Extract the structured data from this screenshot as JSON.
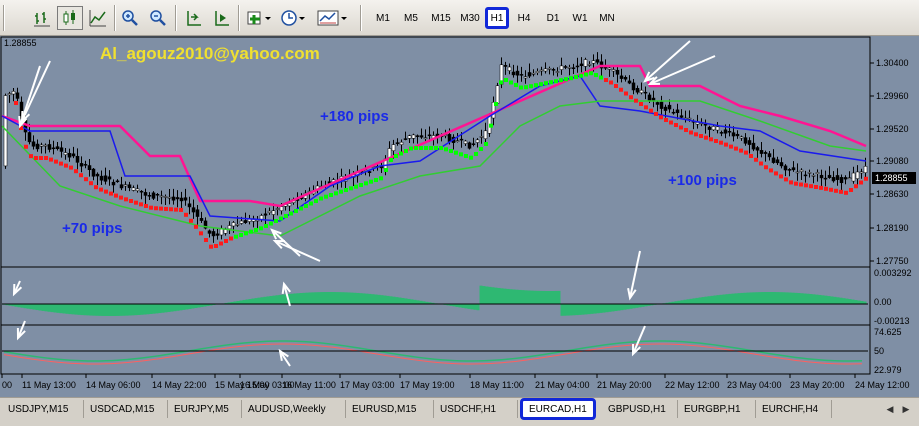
{
  "toolbar": {
    "timeframes": [
      "M1",
      "M5",
      "M15",
      "M30",
      "H1",
      "H4",
      "D1",
      "W1",
      "MN"
    ],
    "active_timeframe": "H1",
    "icons": [
      "bar-chart-icon",
      "candlestick-chart-icon",
      "line-chart-icon",
      "zoom-in-icon",
      "zoom-out-icon",
      "chart-shift-icon",
      "autoscroll-icon",
      "indicators-icon",
      "periods-icon",
      "templates-icon"
    ]
  },
  "chart": {
    "top_left_price": "1.28855",
    "watermark": "Al_agouz2010@yahoo.com",
    "annotations": [
      "+180 pips",
      "+70 pips",
      "+100 pips"
    ],
    "price_scale": [
      "1.30400",
      "1.29960",
      "1.29520",
      "1.29080",
      "1.28855",
      "1.28630",
      "1.28190",
      "1.27750"
    ],
    "current_price": "1.28855",
    "osc1_scale": [
      "0.003292",
      "0.00",
      "-0.00213"
    ],
    "osc2_scale": [
      "74.625",
      "50",
      "22.979"
    ],
    "time_labels": [
      "00",
      "11 May 13:00",
      "14 May 06:00",
      "14 May 22:00",
      "15 May 15:00",
      "16 May 03:00",
      "15 May 19:00",
      "16 May 11:00",
      "17 May 03:00",
      "17 May 19:00",
      "18 May 11:00",
      "21 May 04:00",
      "21 May 20:00",
      "22 May 12:00",
      "23 May 04:00",
      "23 May 20:00",
      "24 May 12:00"
    ],
    "colors": {
      "background": "#7f8fa5",
      "bull": "#00ff00",
      "bear": "#ff0000",
      "pink": "#ff1493",
      "blue": "#0000ff",
      "green_line": "#32cd32"
    }
  },
  "tabs": [
    "USDJPY,M15",
    "USDCAD,M15",
    "EURJPY,M5",
    "AUDUSD,Weekly",
    "EURUSD,M15",
    "USDCHF,H1",
    "EURCAD,H1",
    "GBPUSD,H1",
    "EURGBP,H1",
    "EURCHF,H4"
  ],
  "active_tab": "EURCAD,H1"
}
